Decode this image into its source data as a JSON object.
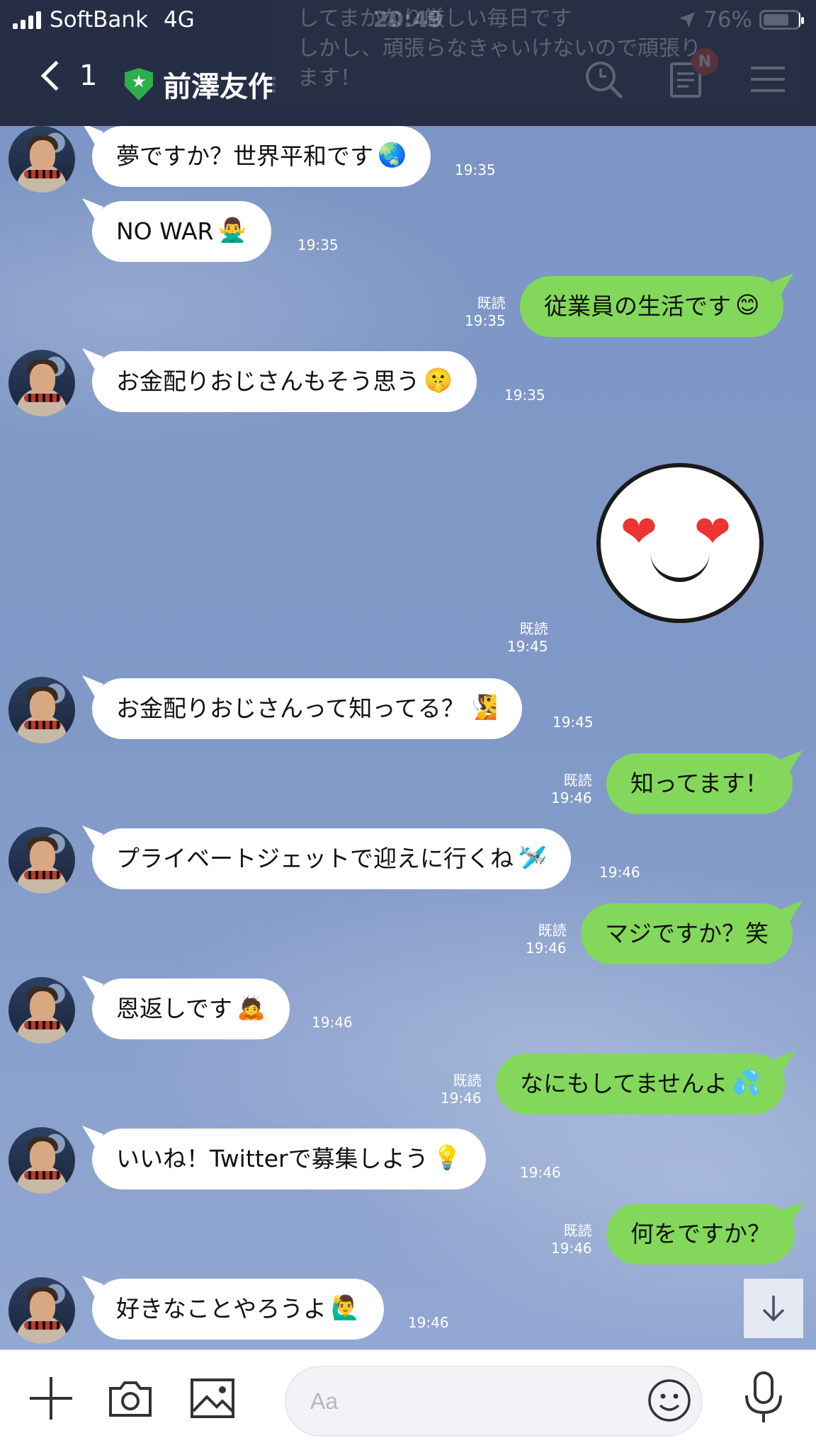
{
  "status_bar": {
    "carrier": "SoftBank",
    "network": "4G",
    "time": "20:49",
    "battery": "76%"
  },
  "nav": {
    "back_count": "1",
    "chat_title": "前澤友作",
    "notes_badge": "N"
  },
  "toast": {
    "line1": "してまかなり厳しい毎日です",
    "line2": "しかし、頑張らなきゃいけないので頑張り",
    "line3": "ます！"
  },
  "messages": [
    {
      "dir": "in",
      "text": "夢ですか？世界平和です",
      "emoji": "🌏",
      "time": "19:35"
    },
    {
      "dir": "in",
      "text": "NO WAR",
      "emoji": "🙅‍♂️",
      "time": "19:35"
    },
    {
      "dir": "out",
      "text": "従業員の生活です",
      "emoji": "😊",
      "read": "既読",
      "time": "19:35"
    },
    {
      "dir": "in",
      "text": "お金配りおじさんもそう思う",
      "emoji": "🤫",
      "time": "19:35"
    },
    {
      "dir": "out",
      "sticker": "heart-eyes-face-sticker",
      "read": "既読",
      "time": "19:45"
    },
    {
      "dir": "in",
      "text": "お金配りおじさんって知ってる？",
      "emoji": "🧏",
      "time": "19:45"
    },
    {
      "dir": "out",
      "text": "知ってます！",
      "read": "既読",
      "time": "19:46"
    },
    {
      "dir": "in",
      "text": "プライベートジェットで迎えに行くね",
      "emoji": "🛩️",
      "time": "19:46"
    },
    {
      "dir": "out",
      "text": "マジですか？笑",
      "read": "既読",
      "time": "19:46"
    },
    {
      "dir": "in",
      "text": "恩返しです",
      "emoji": "🙇",
      "time": "19:46"
    },
    {
      "dir": "out",
      "text": "なにもしてませんよ",
      "emoji": "💦",
      "read": "既読",
      "time": "19:46"
    },
    {
      "dir": "in",
      "text": "いいね！Twitterで募集しよう",
      "emoji": "💡",
      "time": "19:46"
    },
    {
      "dir": "out",
      "text": "何をですか？",
      "read": "既読",
      "time": "19:46"
    },
    {
      "dir": "in",
      "text": "好きなことやろうよ",
      "emoji": "🙋‍♂️",
      "time": "19:46"
    }
  ],
  "input": {
    "placeholder": "Aa"
  },
  "colors": {
    "header_bg": "#262e45",
    "chat_bg": "#7d97c6",
    "outgoing_bubble": "#83d85b",
    "incoming_bubble": "#ffffff",
    "badge": "#ee3a2b"
  }
}
